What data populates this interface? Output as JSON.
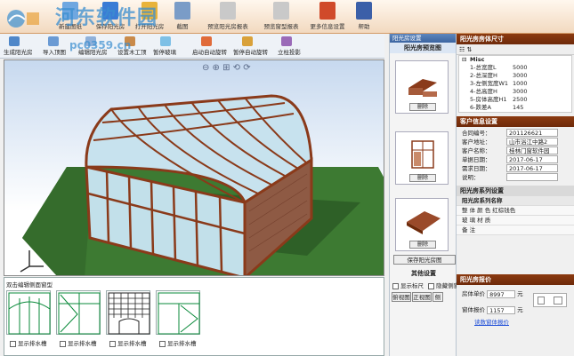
{
  "toolbar": {
    "items": [
      {
        "label": "新建图纸",
        "color": "#6fa7e0"
      },
      {
        "label": "保存阳光房",
        "color": "#3a7bd5"
      },
      {
        "label": "打开阳光房",
        "color": "#e8b33b"
      },
      {
        "label": "截图",
        "color": "#7a9cc7"
      },
      {
        "label": "预览阳光房报表",
        "color": "#c9c9c9"
      },
      {
        "label": "预览窗型报表",
        "color": "#c9c9c9"
      },
      {
        "label": "更多信息设置",
        "color": "#d04a2a"
      },
      {
        "label": "帮助",
        "color": "#3b5fa8"
      }
    ]
  },
  "subtoolbar": {
    "items": [
      "生成阳光房",
      "导入顶图",
      "编辑阳光房",
      "设置木工顶",
      "暂停玻璃",
      "启动自动旋转",
      "暂停自动旋转",
      "立柱投影"
    ]
  },
  "viewtools": "⊖ ⊕ ⊞ ⟲ ⟳",
  "bottom": {
    "title": "双击编辑侧面窗型",
    "checkbox_label": "显示排水槽"
  },
  "preview": {
    "panel_title": "阳光房设置",
    "title": "阳光房预览图",
    "delete_label": "删除",
    "save_label": "保存阳光房图",
    "other_title": "其他设置",
    "checkboxes": [
      "显示标尺",
      "隐藏侧窗"
    ],
    "view_buttons": [
      "俯视图",
      "正视图",
      "侧"
    ]
  },
  "props": {
    "title": "阳光房房体尺寸",
    "group": "Misc",
    "rows": [
      {
        "k": "1-总宽度L",
        "v": "5000"
      },
      {
        "k": "2-总深度H",
        "v": "3000"
      },
      {
        "k": "3-左侧宽度W1",
        "v": "1000"
      },
      {
        "k": "4-总高度H",
        "v": "3000"
      },
      {
        "k": "5-房体高度H1",
        "v": "2500"
      },
      {
        "k": "6-跌差A",
        "v": "145"
      }
    ]
  },
  "customer": {
    "title": "客户信息设置",
    "rows": [
      {
        "k": "合同编号：",
        "v": "201126621"
      },
      {
        "k": "客户地址：",
        "v": "山市浴江中路2"
      },
      {
        "k": "客户名称：",
        "v": "桂林门窗软件园"
      },
      {
        "k": "单据日期：",
        "v": "2017-06-17"
      },
      {
        "k": "需求日期：",
        "v": "2017-06-17"
      },
      {
        "k": "说明：",
        "v": ""
      }
    ]
  },
  "series": {
    "title": "阳光房系列设置",
    "header": "阳光房系列名称",
    "rows": [
      "整 体 颜 色   红棕钱色",
      "玻 璃 材 质",
      "备        注"
    ]
  },
  "pricing": {
    "title": "阳光房报价",
    "unit_price_label": "房体单价",
    "unit_price": "8997",
    "unit": "元",
    "window_price_label": "窗体报价",
    "window_price": "1157",
    "link": "读数窗体报价"
  },
  "watermark": {
    "line1": "河东软件园",
    "line2": "pc0359.cn"
  }
}
